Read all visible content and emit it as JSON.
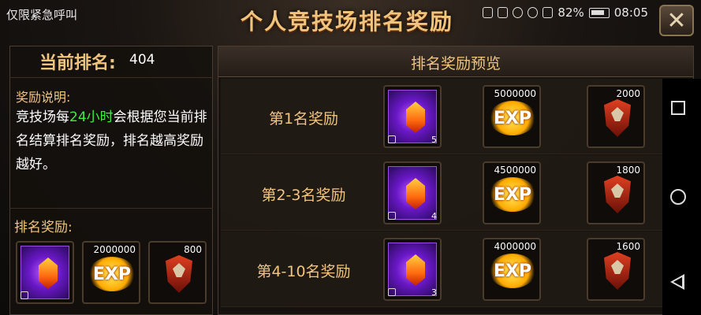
{
  "status_bar": {
    "carrier": "仅限紧急呼叫",
    "battery": "82%",
    "time": "08:05"
  },
  "title": "个人竞技场排名奖励",
  "left": {
    "rank_label": "当前排名:",
    "rank_value": "404",
    "desc_title": "奖励说明:",
    "desc_before": "竞技场每",
    "desc_highlight": "24小时",
    "desc_after": "会根据您当前排名结算排名奖励，排名越高奖励越好。",
    "reward_title": "排名奖励:",
    "rewards": {
      "crystal_count": "",
      "exp_qty": "2000000",
      "shield_qty": "800"
    }
  },
  "preview": {
    "title": "排名奖励预览",
    "rows": [
      {
        "label": "第1名奖励",
        "crystal_count": "5",
        "exp_qty": "5000000",
        "shield_qty": "2000"
      },
      {
        "label": "第2-3名奖励",
        "crystal_count": "4",
        "exp_qty": "4500000",
        "shield_qty": "1800"
      },
      {
        "label": "第4-10名奖励",
        "crystal_count": "3",
        "exp_qty": "4000000",
        "shield_qty": "1600"
      }
    ]
  },
  "icons": {
    "exp_text": "EXP"
  },
  "colors": {
    "gold": "#f1c47e",
    "highlight_green": "#3cf040"
  }
}
